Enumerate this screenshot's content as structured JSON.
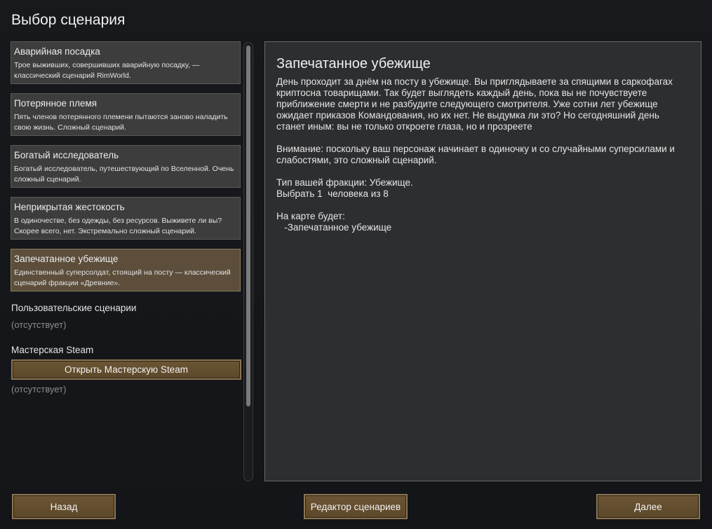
{
  "title": "Выбор сценария",
  "scenarios": [
    {
      "title": "Аварийная посадка",
      "desc": "Трое выживших, совершивших аварийную посадку, — классический сценарий RimWorld."
    },
    {
      "title": "Потерянное племя",
      "desc": "Пять членов потерянного племени пытаются заново наладить свою жизнь. Сложный сценарий."
    },
    {
      "title": "Богатый исследователь",
      "desc": "Богатый исследователь, путешествующий по Вселенной. Очень сложный сценарий."
    },
    {
      "title": "Неприкрытая жестокость",
      "desc": "В одиночестве, без одежды, без ресурсов. Выживете ли вы? Скорее всего, нет. Экстремально сложный сценарий."
    },
    {
      "title": "Запечатанное убежище",
      "desc": "Единственный суперсолдат, стоящий на посту — классический сценарий фракции «Древние»."
    }
  ],
  "custom_section": {
    "label": "Пользовательские сценарии",
    "absent": "(отсутствует)"
  },
  "steam_section": {
    "label": "Мастерская Steam",
    "open_button": "Открыть Мастерскую Steam",
    "absent": "(отсутствует)"
  },
  "detail": {
    "title": "Запечатанное убежище",
    "text": "День проходит за днём на посту в убежище. Вы приглядываете за спящими в саркофагах криптосна товарищами. Так будет выглядеть каждый день, пока вы не почувствуете приближение смерти и не разбудите следующего смотрителя. Уже сотни лет убежище ожидает приказов Командования, но их нет. Не выдумка ли это? Но сегодняшний день станет иным: вы не только откроете глаза, но и прозреете\n\nВнимание: поскольку ваш персонаж начинает в одиночку и со случайными суперсилами и слабостями, это сложный сценарий.\n\nТип вашей фракции: Убежище.\nВыбрать 1  человека из 8\n\nНа карте будет:\n   -Запечатанное убежище"
  },
  "buttons": {
    "back": "Назад",
    "editor": "Редактор сценариев",
    "next": "Далее"
  }
}
